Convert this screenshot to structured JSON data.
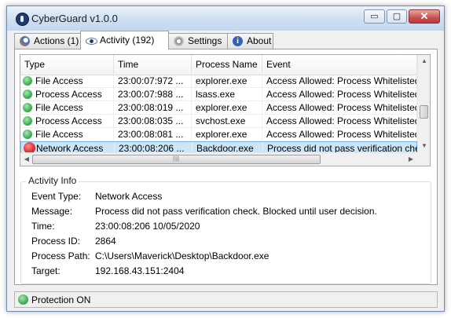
{
  "window": {
    "title": "CyberGuard v1.0.0",
    "min_glyph": "▭",
    "max_glyph": "▢",
    "close_glyph": "✕"
  },
  "tabs": [
    {
      "label": "Actions (1)",
      "icon": "actions-icon"
    },
    {
      "label": "Activity (192)",
      "icon": "eye-icon",
      "active": true
    },
    {
      "label": "Settings",
      "icon": "gear-icon"
    },
    {
      "label": "About",
      "icon": "info-icon",
      "glyph": "i"
    }
  ],
  "grid": {
    "columns": [
      "Type",
      "Time",
      "Process Name",
      "Event"
    ],
    "rows": [
      {
        "status": "green",
        "type": "File Access",
        "time": "23:00:07:972 ...",
        "process": "explorer.exe",
        "event": "Access Allowed: Process Whitelisted"
      },
      {
        "status": "green",
        "type": "Process Access",
        "time": "23:00:07:988 ...",
        "process": "lsass.exe",
        "event": "Access Allowed: Process Whitelisted (Ha"
      },
      {
        "status": "green",
        "type": "File Access",
        "time": "23:00:08:019 ...",
        "process": "explorer.exe",
        "event": "Access Allowed: Process Whitelisted"
      },
      {
        "status": "green",
        "type": "Process Access",
        "time": "23:00:08:035 ...",
        "process": "svchost.exe",
        "event": "Access Allowed: Process Whitelisted"
      },
      {
        "status": "green",
        "type": "File Access",
        "time": "23:00:08:081 ...",
        "process": "explorer.exe",
        "event": "Access Allowed: Process Whitelisted"
      },
      {
        "status": "red",
        "type": "Network Access",
        "time": "23:00:08:206 ...",
        "process": "Backdoor.exe",
        "event": "Process did not pass verification check.",
        "selected": true
      }
    ],
    "scroll": {
      "up": "▲",
      "down": "▼",
      "left": "◀",
      "right": "▶",
      "grip": "|||"
    }
  },
  "activity_info": {
    "title": "Activity Info",
    "fields": [
      {
        "label": "Event Type:",
        "value": "Network Access"
      },
      {
        "label": "Message:",
        "value": "Process did not pass verification check. Blocked until user decision."
      },
      {
        "label": "Time:",
        "value": "23:00:08:206 10/05/2020"
      },
      {
        "label": "Process ID:",
        "value": "2864"
      },
      {
        "label": "Process Path:",
        "value": "C:\\Users\\Maverick\\Desktop\\Backdoor.exe"
      },
      {
        "label": "Target:",
        "value": "192.168.43.151:2404"
      }
    ]
  },
  "status": {
    "text": "Protection ON",
    "color": "#3fae55"
  },
  "colors": {
    "selected_row": "#cde6f7",
    "alert": "#e02a2a",
    "ok": "#3fae55"
  }
}
